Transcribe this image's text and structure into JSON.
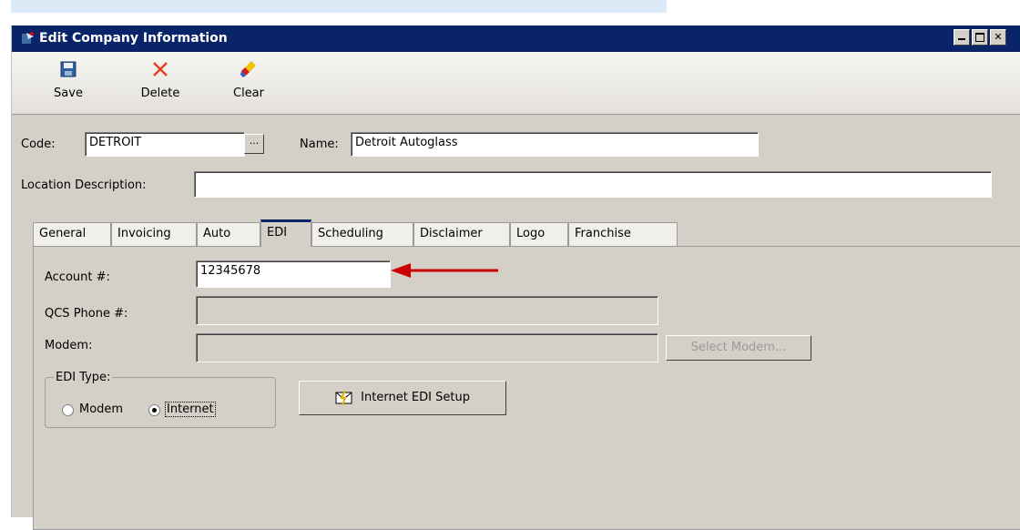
{
  "window": {
    "title": "Edit Company Information"
  },
  "toolbar": {
    "save": "Save",
    "delete": "Delete",
    "clear": "Clear"
  },
  "form": {
    "code_label": "Code:",
    "code_value": "DETROIT",
    "ellipsis": "...",
    "name_label": "Name:",
    "name_value": "Detroit Autoglass",
    "location_label": "Location Description:",
    "location_value": ""
  },
  "tabs": [
    "General",
    "Invoicing",
    "Auto",
    "EDI",
    "Scheduling",
    "Disclaimer",
    "Logo",
    "Franchise"
  ],
  "active_tab": "EDI",
  "edi": {
    "account_label": "Account #:",
    "account_value": "12345678",
    "qcs_label": "QCS Phone #:",
    "qcs_value": "",
    "modem_label": "Modem:",
    "modem_value": "",
    "select_modem_label": "Select Modem...",
    "edi_type_label": "EDI Type:",
    "radio_modem_label": "Modem",
    "radio_internet_label": "Internet",
    "selected_type": "Internet",
    "internet_setup_label": "Internet EDI Setup"
  },
  "colors": {
    "titlebar": "#0a246a",
    "annotation_arrow": "#cc0000"
  }
}
